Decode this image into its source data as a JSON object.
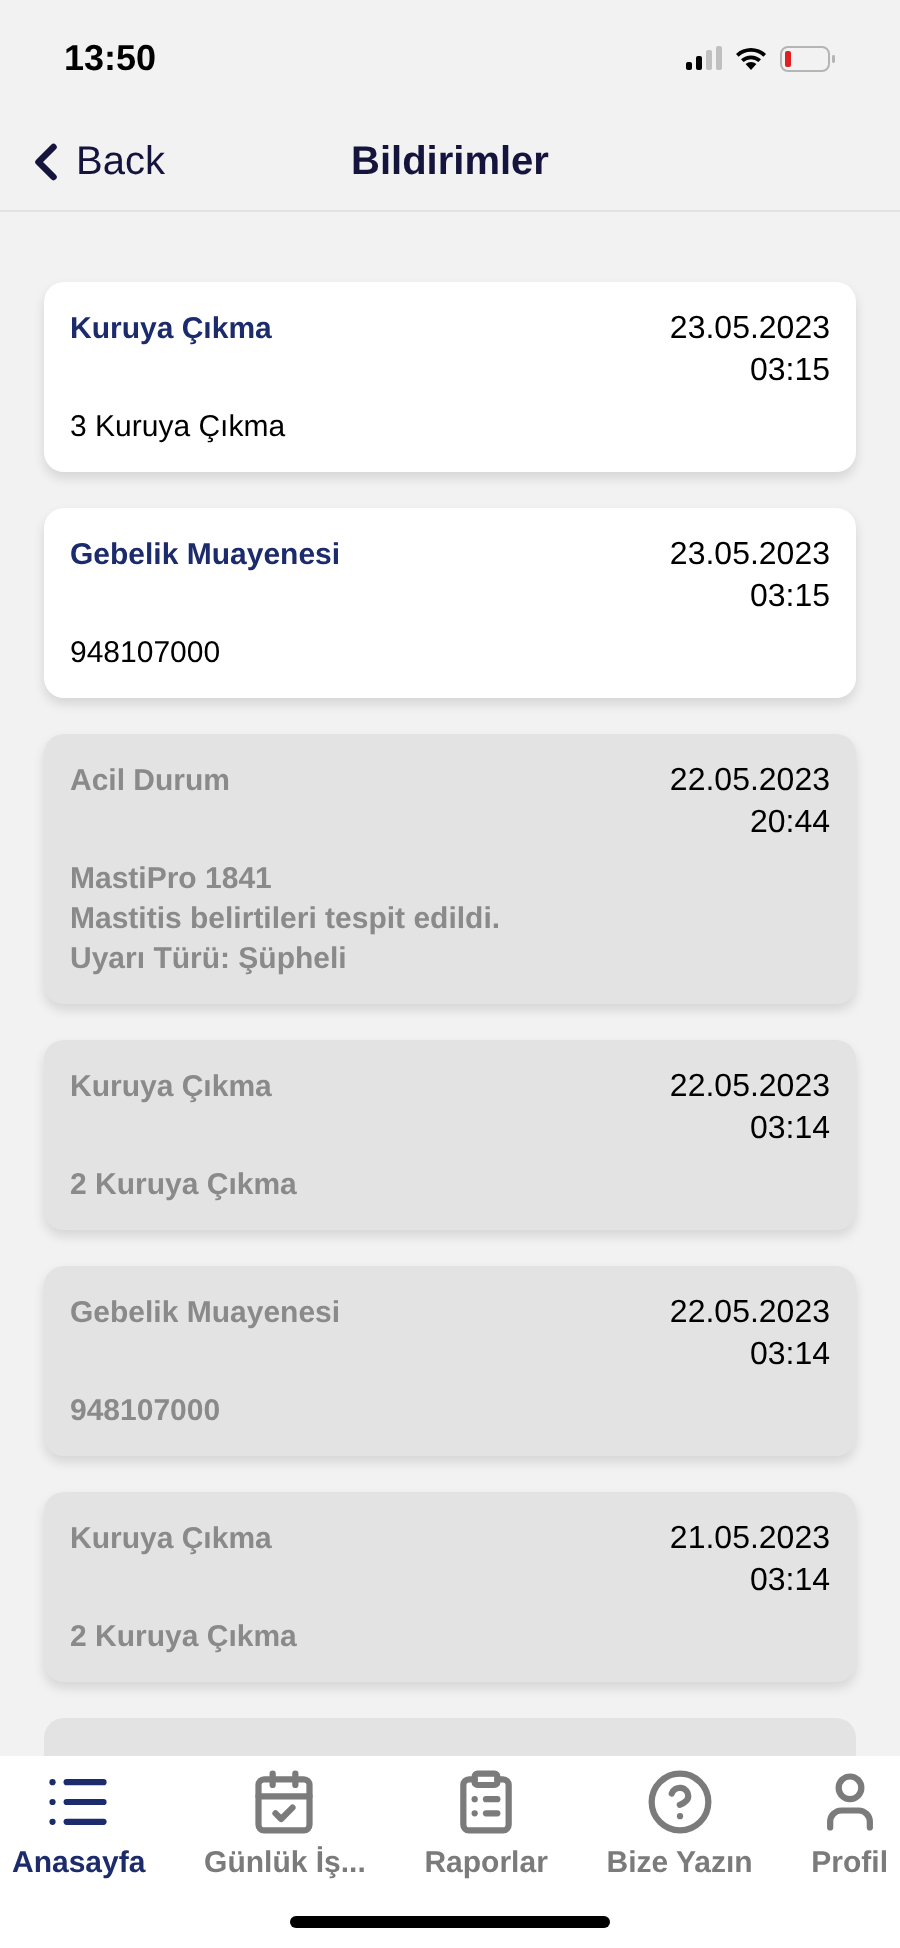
{
  "status_bar": {
    "time": "13:50"
  },
  "nav": {
    "back": "Back",
    "title": "Bildirimler"
  },
  "notifications": [
    {
      "title": "Kuruya Çıkma",
      "date": "23.05.2023",
      "time": "03:15",
      "lines": [
        "3 Kuruya Çıkma"
      ],
      "read": false
    },
    {
      "title": "Gebelik Muayenesi",
      "date": "23.05.2023",
      "time": "03:15",
      "lines": [
        "948107000"
      ],
      "read": false
    },
    {
      "title": "Acil Durum",
      "date": "22.05.2023",
      "time": "20:44",
      "lines": [
        "MastiPro 1841",
        "Mastitis belirtileri tespit edildi.",
        "Uyarı Türü: Şüpheli"
      ],
      "read": true
    },
    {
      "title": "Kuruya Çıkma",
      "date": "22.05.2023",
      "time": "03:14",
      "lines": [
        "2 Kuruya Çıkma"
      ],
      "read": true
    },
    {
      "title": "Gebelik Muayenesi",
      "date": "22.05.2023",
      "time": "03:14",
      "lines": [
        "948107000"
      ],
      "read": true
    },
    {
      "title": "Kuruya Çıkma",
      "date": "21.05.2023",
      "time": "03:14",
      "lines": [
        "2 Kuruya Çıkma"
      ],
      "read": true
    }
  ],
  "partial_card": {
    "read": true
  },
  "tabs": [
    {
      "label": "Anasayfa",
      "kind": "list",
      "selected": true
    },
    {
      "label": "Günlük İş...",
      "kind": "calendar",
      "selected": false
    },
    {
      "label": "Raporlar",
      "kind": "clipboard",
      "selected": false
    },
    {
      "label": "Bize Yazın",
      "kind": "help",
      "selected": false
    },
    {
      "label": "Profil",
      "kind": "user",
      "selected": false
    }
  ]
}
